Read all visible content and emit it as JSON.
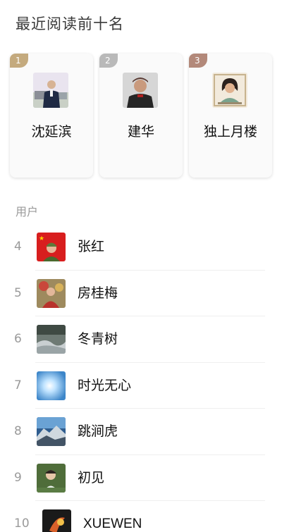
{
  "header": {
    "title": "最近阅读前十名"
  },
  "top3": [
    {
      "rank": "1",
      "name": "沈延滨",
      "badge_color": "#c4aa7e"
    },
    {
      "rank": "2",
      "name": "建华",
      "badge_color": "#b9b9b9"
    },
    {
      "rank": "3",
      "name": "独上月楼",
      "badge_color": "#b3897a"
    }
  ],
  "section": {
    "label": "用户"
  },
  "users": [
    {
      "rank": "4",
      "name": "张红"
    },
    {
      "rank": "5",
      "name": "房桂梅"
    },
    {
      "rank": "6",
      "name": "冬青树"
    },
    {
      "rank": "7",
      "name": "时光无心"
    },
    {
      "rank": "8",
      "name": "跳涧虎"
    },
    {
      "rank": "9",
      "name": "初见"
    },
    {
      "rank": "10",
      "name": "XUEWEN"
    }
  ]
}
